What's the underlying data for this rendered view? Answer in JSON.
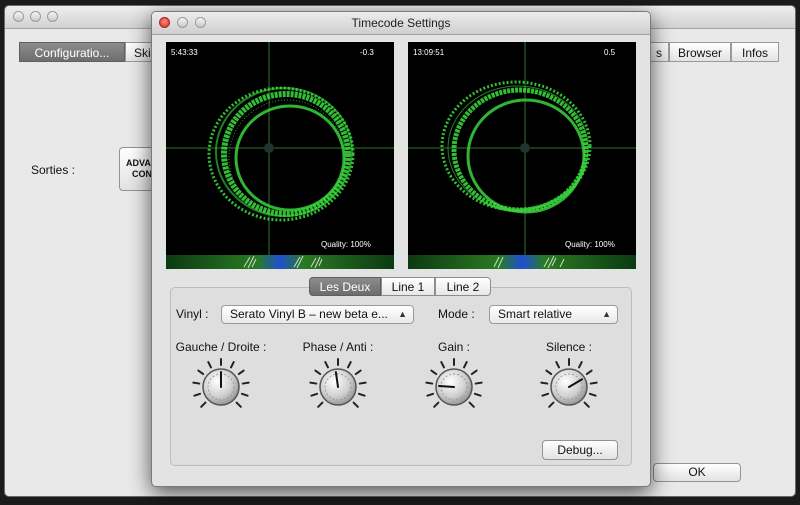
{
  "back_window": {
    "tabs": [
      {
        "label": "Configuratio..."
      },
      {
        "label": "Ski"
      },
      {
        "label": "s"
      },
      {
        "label": "Browser"
      },
      {
        "label": "Infos"
      }
    ],
    "outputs_label": "Sorties :",
    "advanced_button": [
      "ADVAN",
      "CON"
    ],
    "ok_button": "OK"
  },
  "dialog": {
    "title": "Timecode Settings",
    "scopes": [
      {
        "time": "5:43:33",
        "value": "-0.3",
        "quality": "Quality: 100%"
      },
      {
        "time": "13:09:51",
        "value": "0.5",
        "quality": "Quality: 100%"
      }
    ],
    "segments": [
      {
        "label": "Les Deux",
        "active": true
      },
      {
        "label": "Line 1",
        "active": false
      },
      {
        "label": "Line 2",
        "active": false
      }
    ],
    "vinyl": {
      "label": "Vinyl :",
      "value": "Serato Vinyl B – new beta e..."
    },
    "mode": {
      "label": "Mode :",
      "value": "Smart relative"
    },
    "knobs": [
      {
        "label": "Gauche / Droite :",
        "level": 0.5
      },
      {
        "label": "Phase / Anti :",
        "level": 0.47
      },
      {
        "label": "Gain :",
        "level": 0.18
      },
      {
        "label": "Silence :",
        "level": 0.72
      }
    ],
    "debug_button": "Debug...",
    "colors": {
      "scope_trace": "#39d23c",
      "scope_bg": "#000000",
      "accent": "#7a7a7a"
    }
  }
}
